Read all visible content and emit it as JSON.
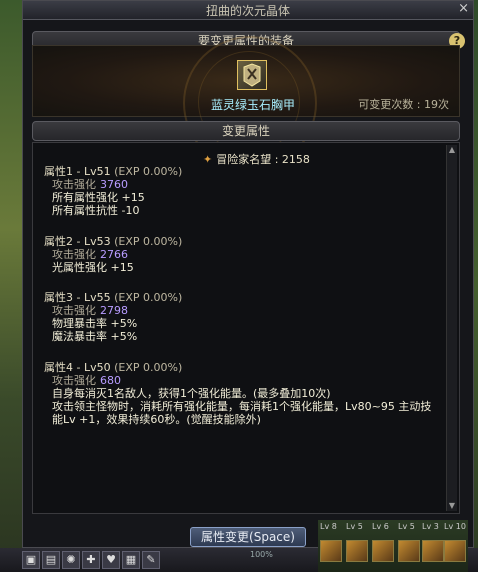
{
  "window": {
    "title": "扭曲的次元晶体",
    "close_label": "×"
  },
  "equip_section": {
    "header": "要变更属性的装备",
    "help_label": "?",
    "item_name": "蓝灵绿玉石胸甲",
    "remaining_label": "可变更次数 : 19次"
  },
  "change_section": {
    "header": "变更属性",
    "fame_label": "冒险家名望 : 2158"
  },
  "attributes": [
    {
      "title": "属性1 - Lv51",
      "exp": "(EXP 0.00%)",
      "enhance_label": "攻击强化",
      "enhance_value": "3760",
      "lines": [
        "所有属性强化 +15",
        "所有属性抗性 -10"
      ]
    },
    {
      "title": "属性2 - Lv53",
      "exp": "(EXP 0.00%)",
      "enhance_label": "攻击强化",
      "enhance_value": "2766",
      "lines": [
        "光属性强化 +15"
      ]
    },
    {
      "title": "属性3 - Lv55",
      "exp": "(EXP 0.00%)",
      "enhance_label": "攻击强化",
      "enhance_value": "2798",
      "lines": [
        "物理暴击率 +5%",
        "魔法暴击率 +5%"
      ]
    },
    {
      "title": "属性4 - Lv50",
      "exp": "(EXP 0.00%)",
      "enhance_label": "攻击强化",
      "enhance_value": "680",
      "lines": [
        "自身每消灭1名敌人，获得1个强化能量。(最多叠加10次)",
        "攻击领主怪物时，消耗所有强化能量，每消耗1个强化能量，Lv80~95 主动技",
        "能Lv +1，效果持续60秒。(觉醒技能除外)"
      ]
    }
  ],
  "buttons": {
    "change_attr": "属性变更(Space)"
  },
  "status": {
    "hp_percent": "100%"
  },
  "skill_levels": [
    "Lv 8",
    "Lv 5",
    "Lv 6",
    "Lv 5",
    "Lv 3",
    "Lv 10"
  ]
}
